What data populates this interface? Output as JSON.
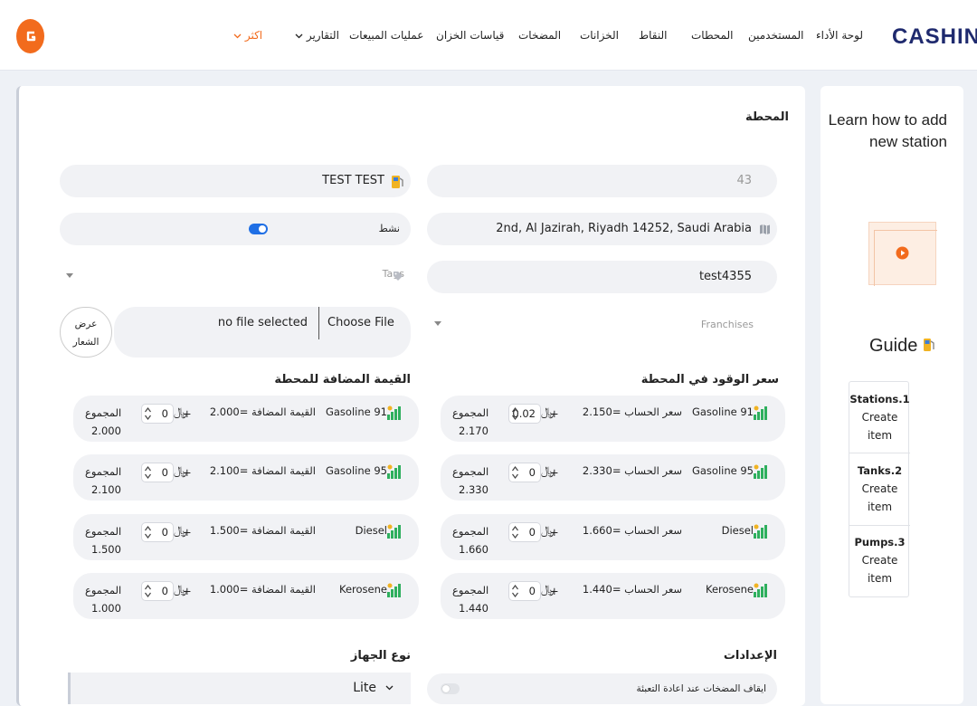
{
  "brand": {
    "logo_text": "CASHIN",
    "accent_color": "#f26b1d",
    "navy_color": "#1f2a6e"
  },
  "nav": {
    "dashboard": "لوحة الأداء",
    "users": "المستخدمين",
    "stations": "المحطات",
    "points": "النقاط",
    "tanks": "الخزانات",
    "pumps": "المضخات",
    "tank_measurements": "قياسات الخزان",
    "sales": "عمليات المبيعات",
    "reports": "التقارير",
    "more": "اكثر"
  },
  "side": {
    "learn_line1": "Learn how to add",
    "learn_line2": "new station",
    "guide_title": "Guide",
    "guide_items": [
      {
        "title": "Stations.1",
        "action1": "Create",
        "action2": "item"
      },
      {
        "title": "Tanks.2",
        "action1": "Create",
        "action2": "item"
      },
      {
        "title": "Pumps.3",
        "action1": "Create",
        "action2": "item"
      }
    ]
  },
  "form": {
    "section_title": "المحطة",
    "station_id": "43",
    "station_name": "TEST TEST",
    "address": "2nd, Al Jazirah, Riyadh 14252, Saudi Arabia",
    "active_label": "نشط",
    "active_on": true,
    "code": "test4355",
    "tags_placeholder": "Tags",
    "franchises_placeholder": "Franchises",
    "file_button": "Choose File",
    "file_status": "no file selected",
    "show_logo_line1": "عرض",
    "show_logo_line2": "الشعار"
  },
  "fuel_prices": {
    "title": "سعر الوقود في المحطة",
    "price_label": "سعر الحساب =",
    "total_label": "المجموع",
    "plus": "+",
    "currency": "﷼",
    "items": [
      {
        "name": "Gasoline 91",
        "price": "2.150",
        "input": "0.02",
        "total": "2.170"
      },
      {
        "name": "Gasoline 95",
        "price": "2.330",
        "input": "0",
        "total": "2.330"
      },
      {
        "name": "Diesel",
        "price": "1.660",
        "input": "0",
        "total": "1.660"
      },
      {
        "name": "Kerosene",
        "price": "1.440",
        "input": "0",
        "total": "1.440"
      }
    ]
  },
  "vat": {
    "title": "القيمة المضافة للمحطة",
    "value_label": "القيمة المضافة =",
    "total_label": "المجموع",
    "plus": "+",
    "currency": "﷼",
    "items": [
      {
        "name": "Gasoline 91",
        "value": "2.000",
        "input": "0",
        "total": "2.000"
      },
      {
        "name": "Gasoline 95",
        "value": "2.100",
        "input": "0",
        "total": "2.100"
      },
      {
        "name": "Diesel",
        "value": "1.500",
        "input": "0",
        "total": "1.500"
      },
      {
        "name": "Kerosene",
        "value": "1.000",
        "input": "0",
        "total": "1.000"
      }
    ]
  },
  "settings": {
    "title": "الإعدادات",
    "stop_pumps_label": "ايقاف المضخات عند اعادة التعبئة",
    "stop_pumps_on": false
  },
  "device": {
    "title": "نوع الجهاز",
    "selected": "Lite"
  }
}
